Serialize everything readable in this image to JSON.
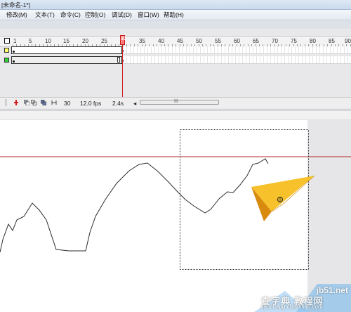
{
  "window": {
    "title": "[未命名-1*]"
  },
  "menu": {
    "items": [
      "修改(M)",
      "文本(T)",
      "命令(C)",
      "控制(O)",
      "调试(D)",
      "窗口(W)",
      "帮助(H)"
    ]
  },
  "timeline": {
    "ruler_numbers": [
      "1",
      "5",
      "10",
      "15",
      "20",
      "25",
      "30",
      "35",
      "40",
      "45",
      "50",
      "55",
      "60",
      "65",
      "70",
      "75",
      "80",
      "85",
      "90"
    ],
    "current_frame_marker": "30",
    "layers": [
      {
        "swatch_color": "#ffff66"
      },
      {
        "swatch_color": "#33cc33"
      }
    ],
    "footer": {
      "current_frame": "30",
      "frame_rate": "12.0 fps",
      "elapsed_time": "2.4s",
      "scroll_grip": "III",
      "scroll_left_arrow": "◂"
    }
  },
  "stage": {
    "guide_color": "#b3262c",
    "path_color": "#2d2d2d",
    "plane_colors": [
      "#f6c12a",
      "#eaa31a",
      "#d88a0f"
    ]
  },
  "watermark": {
    "site": "jb51.net",
    "chinese": "查字典 教程网",
    "url": "jiaocheng.chazidian.com"
  }
}
